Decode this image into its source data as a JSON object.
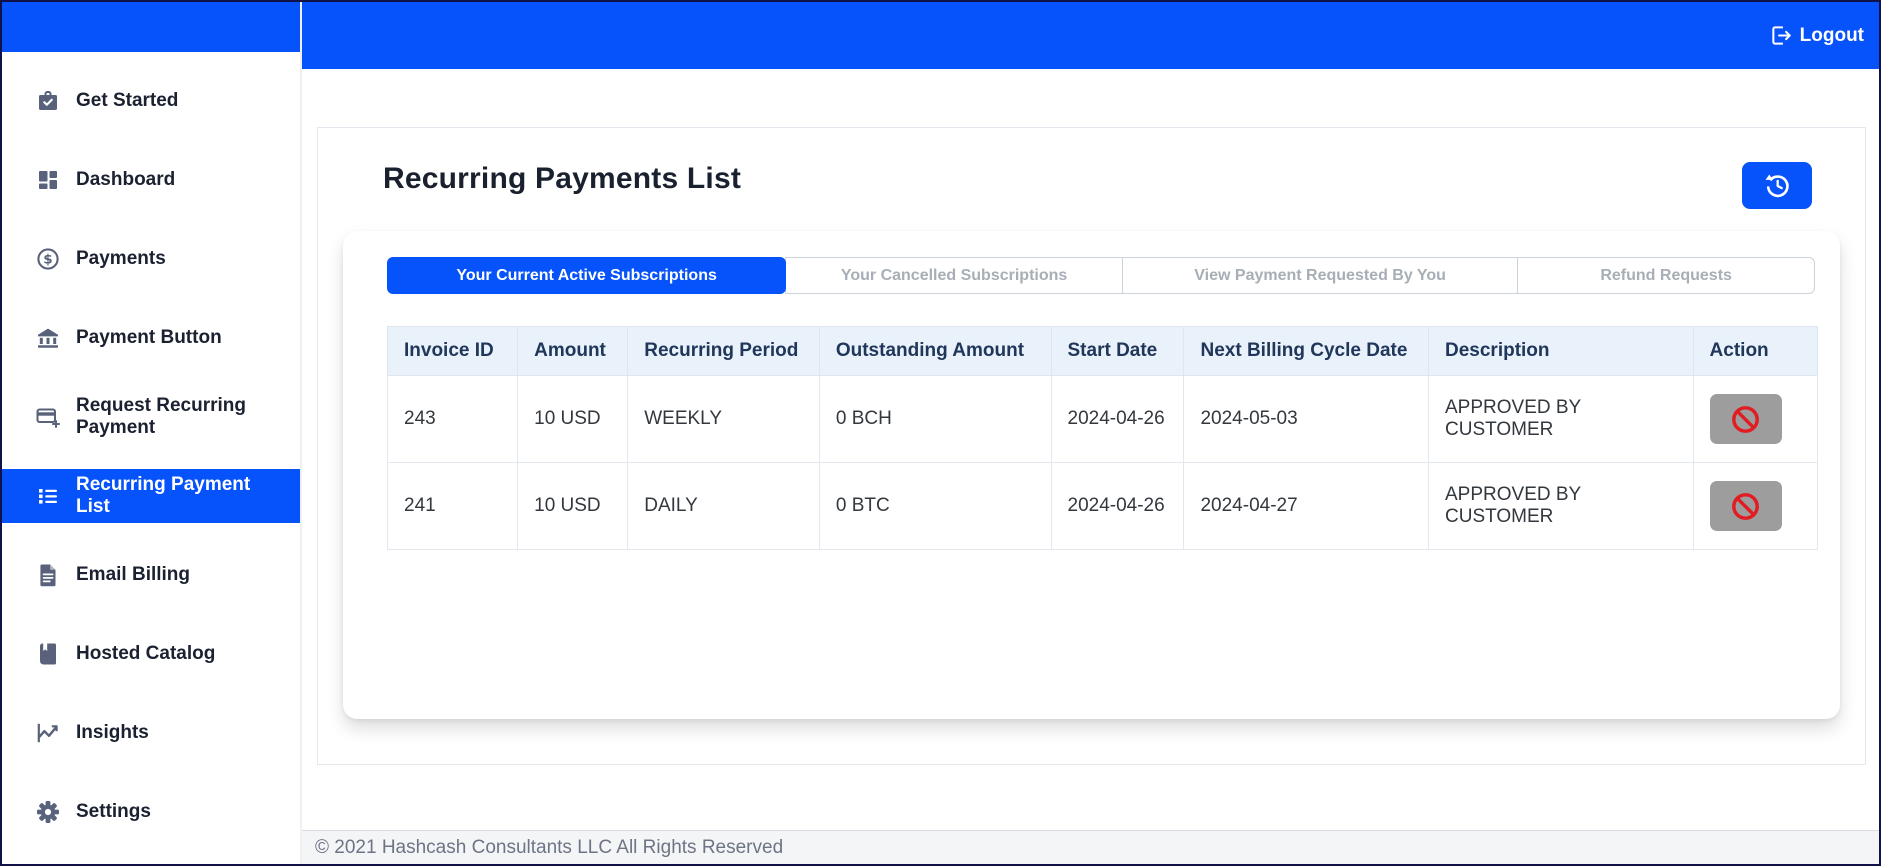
{
  "header": {
    "logout_label": "Logout",
    "logout_icon": "sign-out-icon"
  },
  "sidebar": {
    "items": [
      {
        "label": "Get Started",
        "icon": "briefcase-check-icon",
        "active": false
      },
      {
        "label": "Dashboard",
        "icon": "dashboard-grid-icon",
        "active": false
      },
      {
        "label": "Payments",
        "icon": "dollar-circle-icon",
        "active": false
      },
      {
        "label": "Payment Button",
        "icon": "bank-icon",
        "active": false
      },
      {
        "label": "Request Recurring Payment",
        "icon": "card-plus-icon",
        "active": false
      },
      {
        "label": "Recurring Payment List",
        "icon": "list-icon",
        "active": true
      },
      {
        "label": "Email Billing",
        "icon": "document-icon",
        "active": false
      },
      {
        "label": "Hosted Catalog",
        "icon": "book-icon",
        "active": false
      },
      {
        "label": "Insights",
        "icon": "chart-line-icon",
        "active": false
      },
      {
        "label": "Settings",
        "icon": "gear-icon",
        "active": false
      }
    ]
  },
  "main": {
    "title": "Recurring Payments List",
    "refresh_icon": "history-icon",
    "tabs": [
      {
        "label": "Your Current Active Subscriptions",
        "active": true
      },
      {
        "label": "Your Cancelled Subscriptions",
        "active": false
      },
      {
        "label": "View Payment Requested By You",
        "active": false
      },
      {
        "label": "Refund Requests",
        "active": false
      }
    ],
    "table": {
      "columns": [
        "Invoice ID",
        "Amount",
        "Recurring Period",
        "Outstanding Amount",
        "Start Date",
        "Next Billing Cycle Date",
        "Description",
        "Action"
      ],
      "rows": [
        {
          "invoice_id": "243",
          "amount": "10 USD",
          "recurring_period": "WEEKLY",
          "outstanding_amount": "0 BCH",
          "start_date": "2024-04-26",
          "next_billing_cycle_date": "2024-05-03",
          "description": "APPROVED BY CUSTOMER",
          "action_icon": "ban-icon"
        },
        {
          "invoice_id": "241",
          "amount": "10 USD",
          "recurring_period": "DAILY",
          "outstanding_amount": "0 BTC",
          "start_date": "2024-04-26",
          "next_billing_cycle_date": "2024-04-27",
          "description": "APPROVED BY CUSTOMER",
          "action_icon": "ban-icon"
        }
      ]
    }
  },
  "footer": {
    "copyright": "© 2021 Hashcash Consultants LLC All Rights Reserved"
  },
  "colors": {
    "primary_blue": "#0652fb",
    "table_header_bg": "#e9f1fb",
    "table_header_text": "#20375a",
    "inactive_tab_text": "#a7aeb6",
    "sidebar_icon": "#59627a",
    "action_button_bg": "#9d9d9d",
    "ban_icon_red": "#e11c22",
    "footer_bg": "#f4f5f7"
  }
}
